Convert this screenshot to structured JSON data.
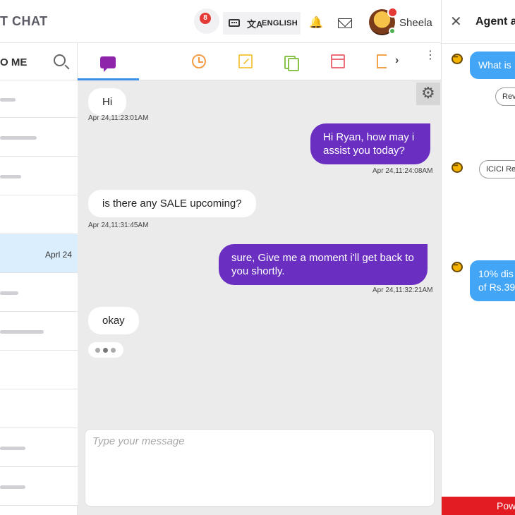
{
  "header": {
    "brand": "T CHAT",
    "notification_count": "8",
    "language": "ENGLISH",
    "translate_glyph": "文A",
    "user_name": "Sheela"
  },
  "left_list": {
    "title": "O ME",
    "active_date": "Aprl 24"
  },
  "chat": {
    "messages": [
      {
        "text": "Hi",
        "time": "Apr 24,11:23:01AM"
      },
      {
        "text": "Hi Ryan, how may i assist you today?",
        "time": "Apr 24,11:24:08AM"
      },
      {
        "text": "is there any SALE upcoming?",
        "time": "Apr 24,11:31:45AM"
      },
      {
        "text": "sure, Give me a moment i'll get back to you shortly.",
        "time": "Apr 24,11:32:21AM"
      },
      {
        "text": "okay"
      }
    ],
    "composer_placeholder": "Type your message"
  },
  "right_panel": {
    "title": "Agent a",
    "bubble_1": "What is",
    "chip_1": "Rev",
    "chip_2": "ICICI Re",
    "bubble_2_line1": "10% dis",
    "bubble_2_line2": "of Rs.39",
    "powered": "Pow"
  },
  "icons": {
    "close": "✕",
    "chevron": "›",
    "kebab": "⋮",
    "bell": "🔔",
    "gear": "⚙"
  },
  "colors": {
    "outgoing_bubble": "#6a2fc0",
    "agent_bubble": "#42a5f5",
    "active_row": "#dbeefd",
    "powered_bar": "#e31b23",
    "active_tab_underline": "#3b8fe8"
  }
}
